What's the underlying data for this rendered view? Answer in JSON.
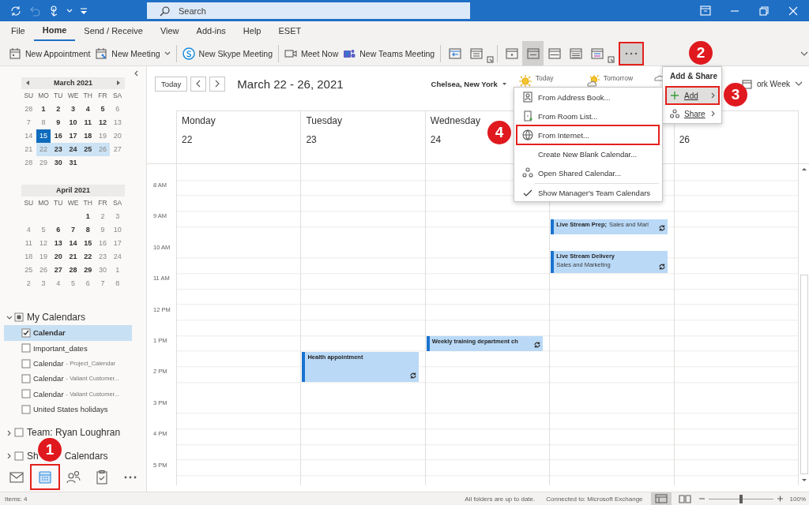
{
  "title_bar": {
    "search": {
      "placeholder": "Search"
    }
  },
  "ribbon_tabs": [
    {
      "label": "File",
      "selected": false
    },
    {
      "label": "Home",
      "selected": true
    },
    {
      "label": "Send / Receive",
      "selected": false
    },
    {
      "label": "View",
      "selected": false
    },
    {
      "label": "Add-ins",
      "selected": false
    },
    {
      "label": "Help",
      "selected": false
    },
    {
      "label": "ESET",
      "selected": false
    }
  ],
  "ribbon": {
    "commands": [
      {
        "label": "New Appointment",
        "has_menu": false
      },
      {
        "label": "New Meeting",
        "has_menu": true
      },
      {
        "label": "New Skype Meeting",
        "has_menu": false
      },
      {
        "label": "Meet Now",
        "has_menu": false
      },
      {
        "label": "New Teams Meeting",
        "has_menu": false
      }
    ],
    "view_buttons": [
      {
        "selected": false
      },
      {
        "selected": true
      },
      {
        "selected": false
      },
      {
        "selected": false
      },
      {
        "selected": false
      }
    ],
    "more_button": {
      "expanded": true,
      "outlined": true
    }
  },
  "sidebar": {
    "mini_calendars": [
      {
        "title": "March 2021",
        "has_arrows": true,
        "weekdays": [
          "SU",
          "MO",
          "TU",
          "WE",
          "TH",
          "FR",
          "SA"
        ],
        "weeks": [
          [
            {
              "d": "28",
              "bold": false,
              "selected": false,
              "today": false
            },
            {
              "d": "1",
              "bold": true,
              "selected": false,
              "today": false
            },
            {
              "d": "2",
              "bold": true,
              "selected": false,
              "today": false
            },
            {
              "d": "3",
              "bold": true,
              "selected": false,
              "today": false
            },
            {
              "d": "4",
              "bold": true,
              "selected": false,
              "today": false
            },
            {
              "d": "5",
              "bold": true,
              "selected": false,
              "today": false
            },
            {
              "d": "6",
              "bold": false,
              "selected": false,
              "today": false
            }
          ],
          [
            {
              "d": "7",
              "bold": false,
              "selected": false,
              "today": false
            },
            {
              "d": "8",
              "bold": false,
              "selected": false,
              "today": false
            },
            {
              "d": "9",
              "bold": true,
              "selected": false,
              "today": false
            },
            {
              "d": "10",
              "bold": true,
              "selected": false,
              "today": false
            },
            {
              "d": "11",
              "bold": true,
              "selected": false,
              "today": false
            },
            {
              "d": "12",
              "bold": true,
              "selected": false,
              "today": false
            },
            {
              "d": "13",
              "bold": false,
              "selected": false,
              "today": false
            }
          ],
          [
            {
              "d": "14",
              "bold": false,
              "selected": false,
              "today": false
            },
            {
              "d": "15",
              "bold": false,
              "selected": false,
              "today": true
            },
            {
              "d": "16",
              "bold": true,
              "selected": false,
              "today": false
            },
            {
              "d": "17",
              "bold": true,
              "selected": false,
              "today": false
            },
            {
              "d": "18",
              "bold": true,
              "selected": false,
              "today": false
            },
            {
              "d": "19",
              "bold": false,
              "selected": false,
              "today": false
            },
            {
              "d": "20",
              "bold": false,
              "selected": false,
              "today": false
            }
          ],
          [
            {
              "d": "21",
              "bold": false,
              "selected": false,
              "today": false
            },
            {
              "d": "22",
              "bold": false,
              "selected": true,
              "today": false
            },
            {
              "d": "23",
              "bold": true,
              "selected": true,
              "today": false
            },
            {
              "d": "24",
              "bold": true,
              "selected": true,
              "today": false
            },
            {
              "d": "25",
              "bold": true,
              "selected": true,
              "today": false
            },
            {
              "d": "26",
              "bold": false,
              "selected": true,
              "today": false
            },
            {
              "d": "27",
              "bold": false,
              "selected": false,
              "today": false
            }
          ],
          [
            {
              "d": "28",
              "bold": false,
              "selected": false,
              "today": false
            },
            {
              "d": "29",
              "bold": false,
              "selected": false,
              "today": false
            },
            {
              "d": "30",
              "bold": true,
              "selected": false,
              "today": false
            },
            {
              "d": "31",
              "bold": true,
              "selected": false,
              "today": false
            }
          ]
        ]
      },
      {
        "title": "April 2021",
        "has_arrows": false,
        "weekdays": [
          "SU",
          "MO",
          "TU",
          "WE",
          "TH",
          "FR",
          "SA"
        ],
        "weeks": [
          [
            {
              "d": "1",
              "bold": true,
              "selected": false,
              "today": false
            },
            {
              "d": "2",
              "bold": false,
              "selected": false,
              "today": false
            },
            {
              "d": "3",
              "bold": false,
              "selected": false,
              "today": false
            }
          ],
          [
            {
              "d": "4",
              "bold": false,
              "selected": false,
              "today": false
            },
            {
              "d": "5",
              "bold": false,
              "selected": false,
              "today": false
            },
            {
              "d": "6",
              "bold": true,
              "selected": false,
              "today": false
            },
            {
              "d": "7",
              "bold": true,
              "selected": false,
              "today": false
            },
            {
              "d": "8",
              "bold": true,
              "selected": false,
              "today": false
            },
            {
              "d": "9",
              "bold": false,
              "selected": false,
              "today": false
            },
            {
              "d": "10",
              "bold": false,
              "selected": false,
              "today": false
            }
          ],
          [
            {
              "d": "11",
              "bold": false,
              "selected": false,
              "today": false
            },
            {
              "d": "12",
              "bold": false,
              "selected": false,
              "today": false
            },
            {
              "d": "13",
              "bold": true,
              "selected": false,
              "today": false
            },
            {
              "d": "14",
              "bold": true,
              "selected": false,
              "today": false
            },
            {
              "d": "15",
              "bold": true,
              "selected": false,
              "today": false
            },
            {
              "d": "16",
              "bold": false,
              "selected": false,
              "today": false
            },
            {
              "d": "17",
              "bold": false,
              "selected": false,
              "today": false
            }
          ],
          [
            {
              "d": "18",
              "bold": false,
              "selected": false,
              "today": false
            },
            {
              "d": "19",
              "bold": false,
              "selected": false,
              "today": false
            },
            {
              "d": "20",
              "bold": true,
              "selected": false,
              "today": false
            },
            {
              "d": "21",
              "bold": true,
              "selected": false,
              "today": false
            },
            {
              "d": "22",
              "bold": true,
              "selected": false,
              "today": false
            },
            {
              "d": "23",
              "bold": false,
              "selected": false,
              "today": false
            },
            {
              "d": "24",
              "bold": false,
              "selected": false,
              "today": false
            }
          ],
          [
            {
              "d": "25",
              "bold": false,
              "selected": false,
              "today": false
            },
            {
              "d": "26",
              "bold": false,
              "selected": false,
              "today": false
            },
            {
              "d": "27",
              "bold": true,
              "selected": false,
              "today": false
            },
            {
              "d": "28",
              "bold": true,
              "selected": false,
              "today": false
            },
            {
              "d": "29",
              "bold": true,
              "selected": false,
              "today": false
            },
            {
              "d": "30",
              "bold": false,
              "selected": false,
              "today": false
            },
            {
              "d": "1",
              "bold": false,
              "selected": false,
              "today": false
            }
          ],
          [
            {
              "d": "2",
              "bold": false,
              "selected": false,
              "today": false
            },
            {
              "d": "3",
              "bold": false,
              "selected": false,
              "today": false
            },
            {
              "d": "4",
              "bold": false,
              "selected": false,
              "today": false
            },
            {
              "d": "5",
              "bold": false,
              "selected": false,
              "today": false
            },
            {
              "d": "6",
              "bold": false,
              "selected": false,
              "today": false
            },
            {
              "d": "7",
              "bold": false,
              "selected": false,
              "today": false
            },
            {
              "d": "8",
              "bold": false,
              "selected": false,
              "today": false
            }
          ]
        ]
      }
    ],
    "folder_groups": [
      {
        "label": "My Calendars",
        "expanded": true,
        "checked": false,
        "partial": true,
        "children": [
          {
            "name": "Calendar",
            "checked": true,
            "selected": true
          },
          {
            "name": "Important_dates",
            "checked": false,
            "selected": false
          },
          {
            "name": "Calendar",
            "detail": "- Project_Calendar",
            "checked": false,
            "selected": false
          },
          {
            "name": "Calendar",
            "detail": "- Valiant Customer...",
            "checked": false,
            "selected": false
          },
          {
            "name": "Calendar",
            "detail": "- Valiant Customer...",
            "checked": false,
            "selected": false
          },
          {
            "name": "United States holidays",
            "checked": false,
            "selected": false
          }
        ]
      },
      {
        "label": "Team: Ryan Loughran",
        "expanded": false,
        "checked": false,
        "partial": false
      },
      {
        "label": "Sh",
        "label_after_badge": "Calendars",
        "expanded": false,
        "checked": false,
        "partial": false
      }
    ],
    "nav_bar": [
      {
        "selected": false,
        "outlined": false
      },
      {
        "selected": true,
        "outlined": true
      },
      {
        "selected": false,
        "outlined": false
      },
      {
        "selected": false,
        "outlined": false
      },
      {
        "selected": false,
        "outlined": false
      }
    ]
  },
  "calendar": {
    "header": {
      "today_button": "Today",
      "range_title": "March 22 - 26, 2021",
      "location": "Chelsea, New York",
      "weather": [
        {
          "label": "Today",
          "kind": "sunny"
        },
        {
          "label": "Tomorrow",
          "kind": "partly_cloudy"
        },
        {
          "kind": "cloudy"
        }
      ],
      "view_menu": "ork Week"
    },
    "hours": [
      "8 AM",
      "9 AM",
      "10 AM",
      "11 AM",
      "12 PM",
      "1 PM",
      "2 PM",
      "3 PM",
      "4 PM",
      "5 PM"
    ],
    "days": [
      {
        "name": "Monday",
        "date": "22"
      },
      {
        "name": "Tuesday",
        "date": "23",
        "events": [
          {
            "title": "Health appointment",
            "recurring": true
          }
        ]
      },
      {
        "name": "Wednesday",
        "date": "24",
        "events": [
          {
            "title": "Weekly training department ch",
            "recurring": true
          }
        ]
      },
      {
        "events": [
          {
            "title": "Live Stream Prep;",
            "location": "Sales and Marl",
            "recurring": true
          },
          {
            "title": "Live Stream Delivery",
            "location": "Sales and Marketing",
            "recurring": true
          }
        ]
      },
      {
        "date": "26"
      }
    ]
  },
  "add_share_menu": {
    "title": "Add & Share",
    "items": [
      {
        "label": "Add",
        "selected": true,
        "outlined": true
      },
      {
        "label": "Share",
        "selected": false,
        "outlined": false
      }
    ]
  },
  "add_submenu": {
    "items": [
      {
        "label": "From Address Book...",
        "checked": false,
        "outlined": false
      },
      {
        "label": "From Room List...",
        "checked": false,
        "outlined": false
      },
      {
        "label": "From Internet...",
        "checked": false,
        "outlined": true
      },
      {
        "label": "Create New Blank Calendar...",
        "checked": false,
        "outlined": false
      },
      {
        "label": "Open Shared Calendar...",
        "checked": false,
        "outlined": false
      },
      {
        "label": "Show Manager's Team Calendars",
        "checked": true,
        "outlined": false
      }
    ]
  },
  "annotations": [
    {
      "number": "1"
    },
    {
      "number": "2"
    },
    {
      "number": "3"
    },
    {
      "number": "4"
    }
  ],
  "status_bar": {
    "items": "Items: 4",
    "sync": "All folders are up to date.",
    "connection": "Connected to: Microsoft Exchange",
    "views": [
      {
        "selected": true
      },
      {
        "selected": false
      }
    ],
    "zoom": {
      "level": 0.5,
      "reading": "100%"
    }
  }
}
